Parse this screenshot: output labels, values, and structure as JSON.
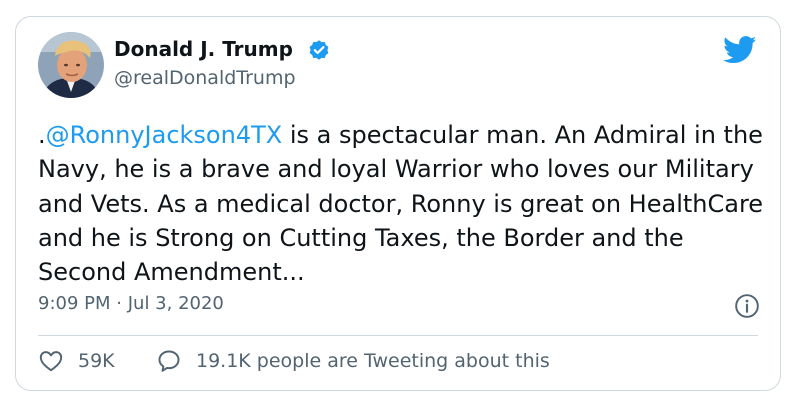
{
  "author": {
    "name": "Donald J. Trump",
    "handle": "@realDonaldTrump"
  },
  "tweet": {
    "prefix": ".",
    "mention": "@RonnyJackson4TX",
    "body": " is a spectacular man. An Admiral in the Navy, he is a brave and loyal Warrior who loves our Military and Vets. As a medical doctor, Ronny is great on HealthCare and he is Strong on Cutting Taxes, the Border and the Second Amendment...",
    "time": "9:09 PM",
    "separator": "·",
    "date": "Jul 3, 2020"
  },
  "stats": {
    "likes": "59K",
    "conversation": "19.1K people are Tweeting about this"
  },
  "colors": {
    "accent": "#1d9bf0",
    "text": "#0f1419",
    "secondary": "#536471",
    "border": "#cfd9de"
  },
  "icons": [
    "verified-badge-icon",
    "twitter-bird-icon",
    "info-icon",
    "heart-icon",
    "speech-bubble-icon"
  ]
}
